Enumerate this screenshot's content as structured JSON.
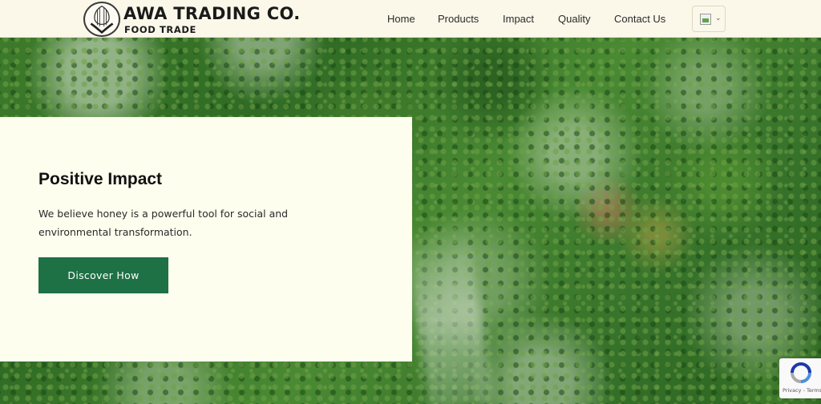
{
  "header": {
    "brand_name": "AWA TRADING CO.",
    "brand_tagline": "FOOD TRADE",
    "nav": [
      {
        "label": "Home"
      },
      {
        "label": "Products"
      },
      {
        "label": "Impact"
      },
      {
        "label": "Quality"
      },
      {
        "label": "Contact Us"
      }
    ],
    "language_selector": {
      "icon": "broken-flag-image-icon",
      "chevron": "chevron-down-icon"
    }
  },
  "hero": {
    "background": "aerial-forest-photo",
    "title": "Positive Impact",
    "text": "We believe honey is a powerful tool for social and environmental transformation.",
    "cta_label": "Discover How"
  },
  "recaptcha": {
    "links": "Privacy - Terms"
  },
  "colors": {
    "header_bg": "#fbf8ea",
    "card_bg": "#fdfeee",
    "cta_bg": "#1e7045",
    "cta_text": "#ffffff",
    "title_text": "#111111",
    "forest_green": "#2f6b24"
  }
}
